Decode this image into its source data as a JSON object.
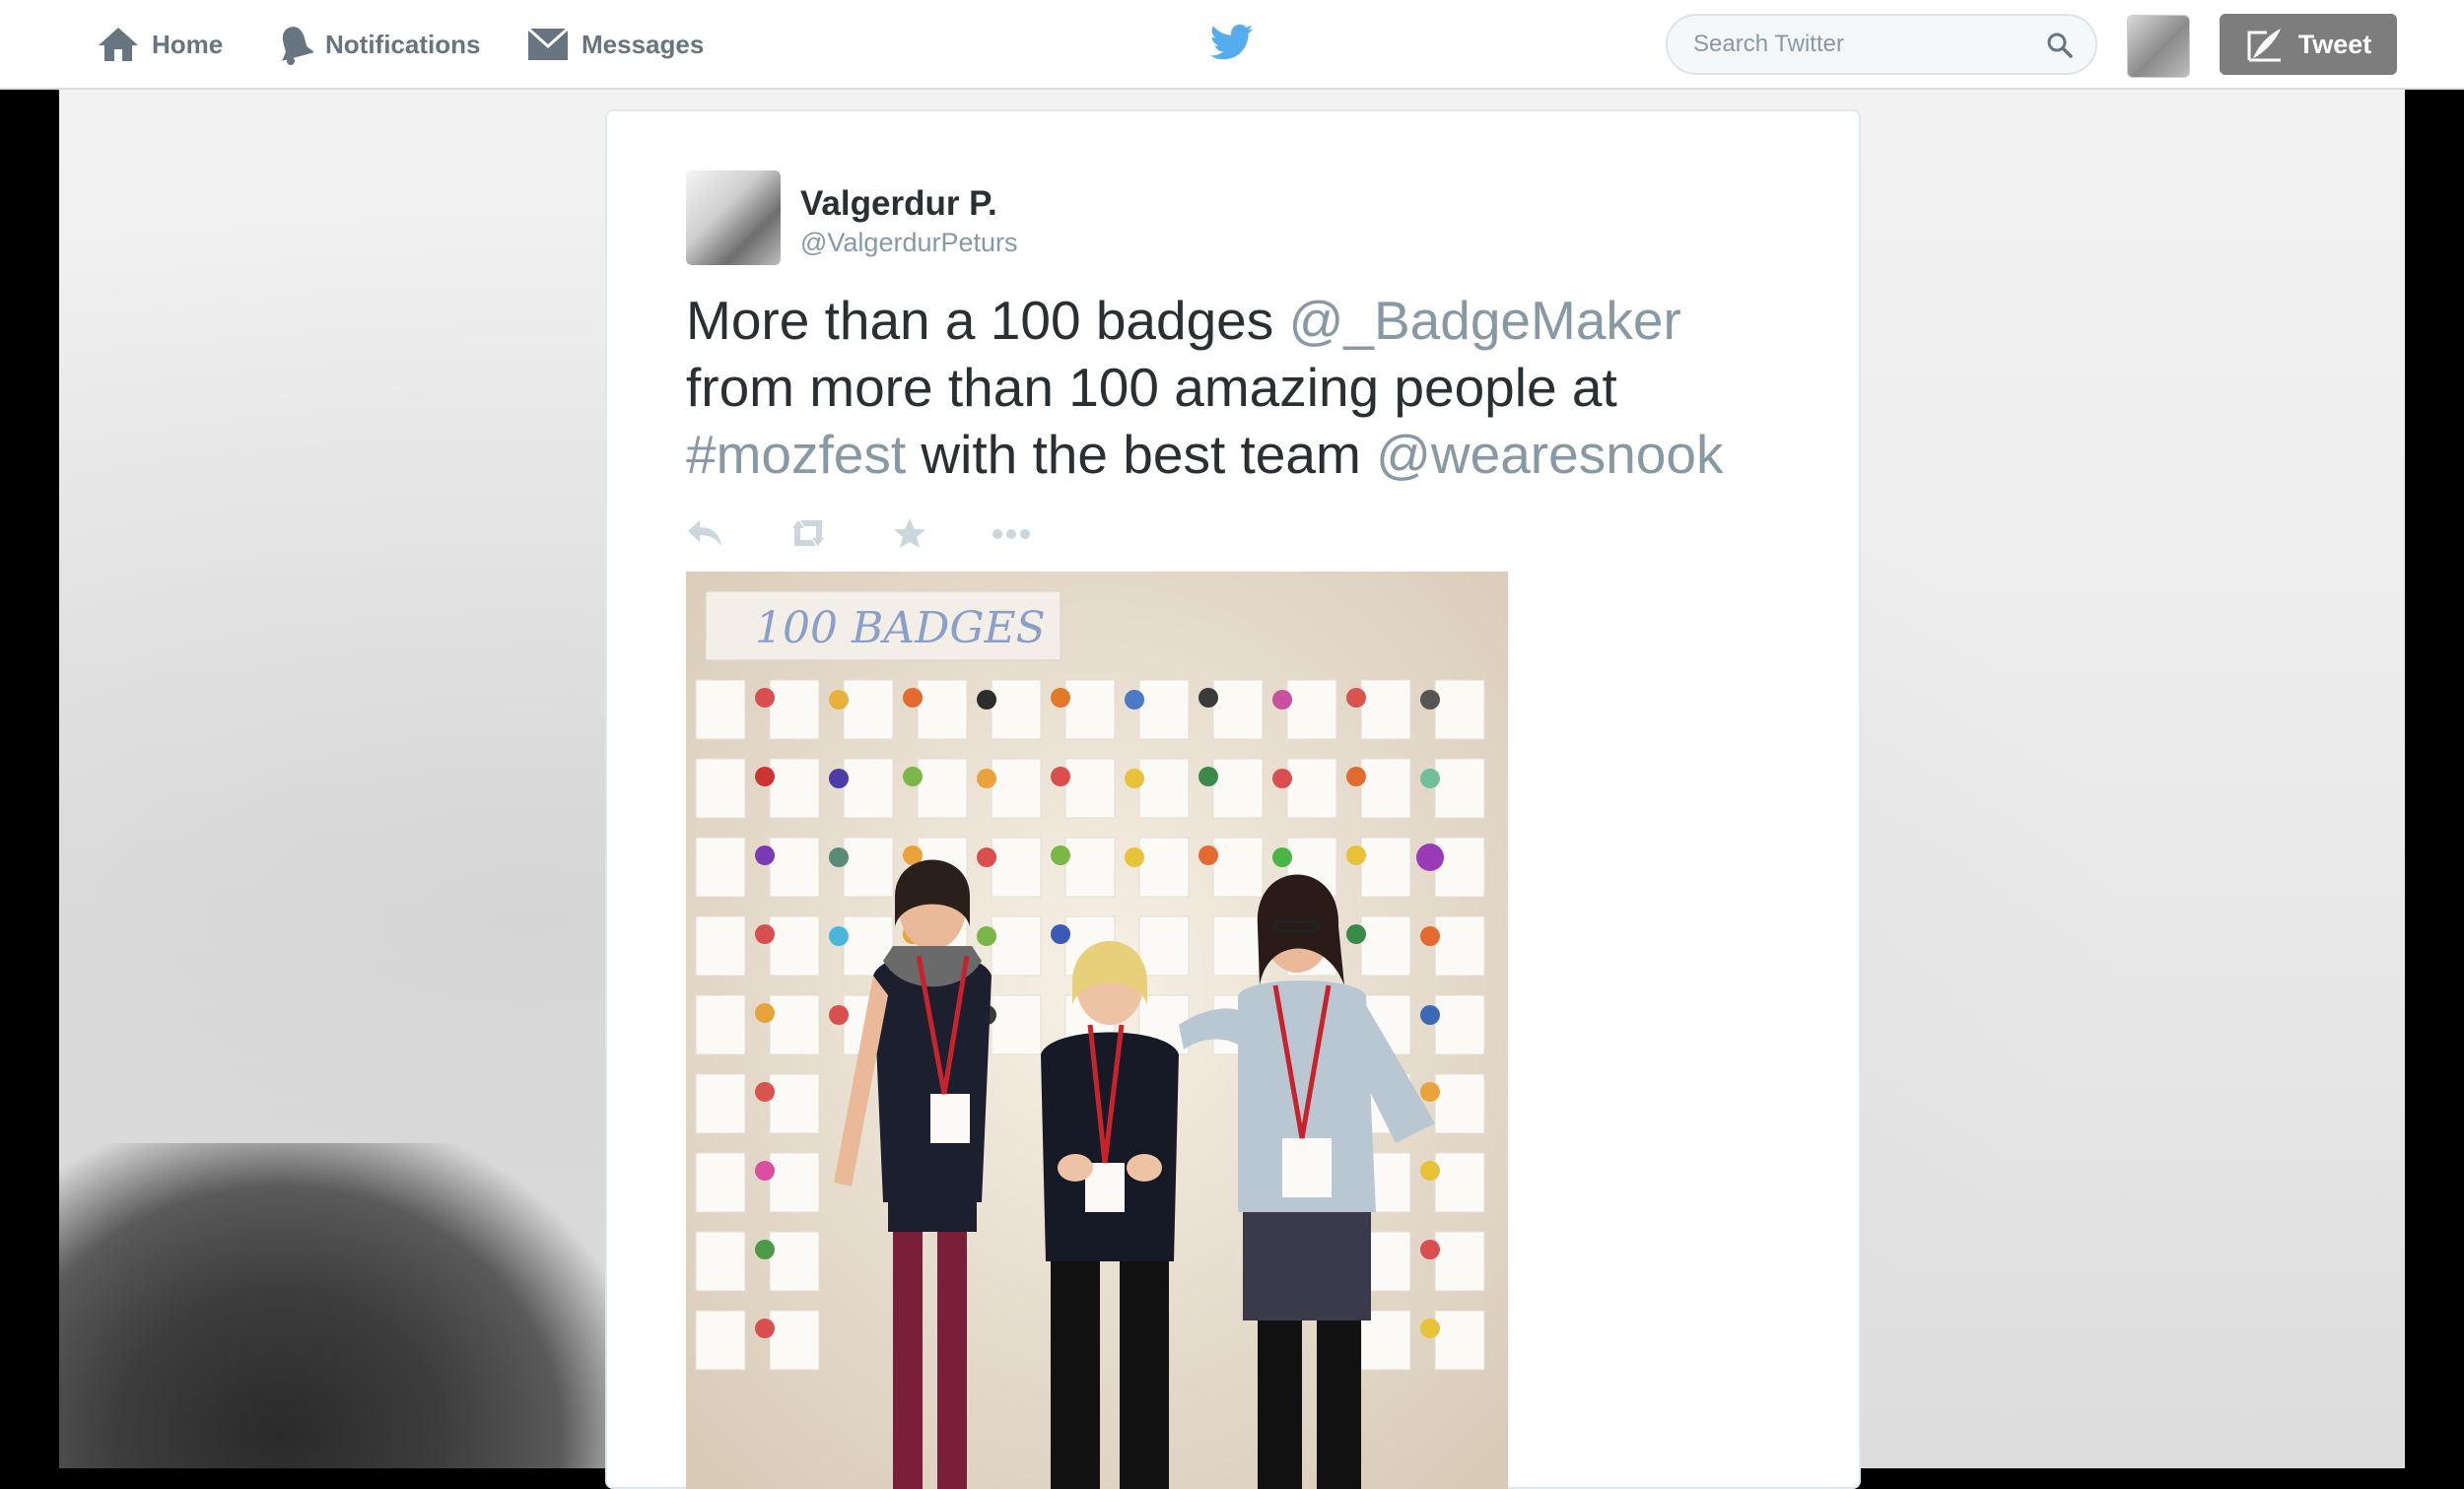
{
  "nav": {
    "home_label": "Home",
    "notifications_label": "Notifications",
    "messages_label": "Messages"
  },
  "search": {
    "placeholder": "Search Twitter"
  },
  "compose": {
    "tweet_label": "Tweet"
  },
  "tweet": {
    "author_name": "Valgerdur P.",
    "author_handle": "@ValgerdurPeturs",
    "text_parts": {
      "p1": "More than a 100 badges ",
      "mention1": "@_BadgeMaker",
      "p2": " from more than 100 amazing people at ",
      "hashtag": "#mozfest",
      "p3": " with the best team ",
      "mention2": "@wearesnook"
    },
    "photo_sign": "100 BADGES"
  },
  "colors": {
    "brand_blue": "#55acee",
    "text_dark": "#292f33",
    "text_muted": "#8899a6",
    "tweet_button": "#7d7d7d"
  },
  "icons": {
    "home": "home-icon",
    "notifications": "bell-icon",
    "messages": "envelope-icon",
    "logo": "twitter-bird-icon",
    "search": "search-icon",
    "compose": "compose-quill-icon",
    "reply": "reply-icon",
    "retweet": "retweet-icon",
    "favorite": "star-icon",
    "more": "more-dots-icon"
  }
}
